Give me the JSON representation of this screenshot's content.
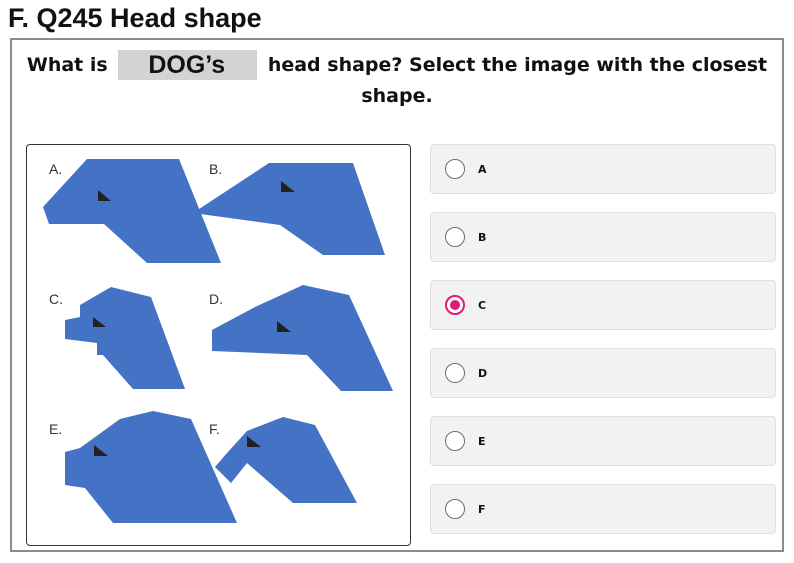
{
  "heading": "F. Q245 Head shape",
  "question": {
    "prefix": "What is",
    "animal": "DOG’s",
    "suffix_line1": "head shape? Select the image with the closest",
    "suffix_line2": "shape."
  },
  "shapes": [
    {
      "letter": "A."
    },
    {
      "letter": "B."
    },
    {
      "letter": "C."
    },
    {
      "letter": "D."
    },
    {
      "letter": "E."
    },
    {
      "letter": "F."
    }
  ],
  "shape_color": "#4472c4",
  "eye_color": "#222222",
  "accent_color": "#e2197b",
  "options": [
    {
      "label": "A",
      "selected": false
    },
    {
      "label": "B",
      "selected": false
    },
    {
      "label": "C",
      "selected": true
    },
    {
      "label": "D",
      "selected": false
    },
    {
      "label": "E",
      "selected": false
    },
    {
      "label": "F",
      "selected": false
    }
  ]
}
